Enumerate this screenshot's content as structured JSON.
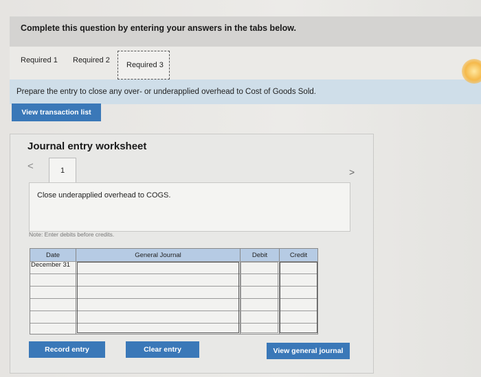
{
  "header": {
    "instruction": "Complete this question by entering your answers in the tabs below."
  },
  "tabs": [
    {
      "label": "Required 1"
    },
    {
      "label": "Required 2"
    },
    {
      "label": "Required 3"
    }
  ],
  "instruction_text": "Prepare the entry to close any over- or underapplied overhead to Cost of Goods Sold.",
  "view_transaction_label": "View transaction list",
  "worksheet": {
    "title": "Journal entry worksheet",
    "prev_symbol": "<",
    "next_symbol": ">",
    "page_number": "1",
    "description": "Close underapplied overhead to COGS.",
    "note": "Note: Enter debits before credits.",
    "columns": {
      "date": "Date",
      "general_journal": "General Journal",
      "debit": "Debit",
      "credit": "Credit"
    },
    "first_date": "December 31"
  },
  "buttons": {
    "record_entry": "Record entry",
    "clear_entry": "Clear entry",
    "view_general_journal": "View general journal"
  },
  "colors": {
    "button_blue": "#3a78b8",
    "header_cell": "#b6cbe4",
    "instruction_bar": "#cfdee9"
  }
}
